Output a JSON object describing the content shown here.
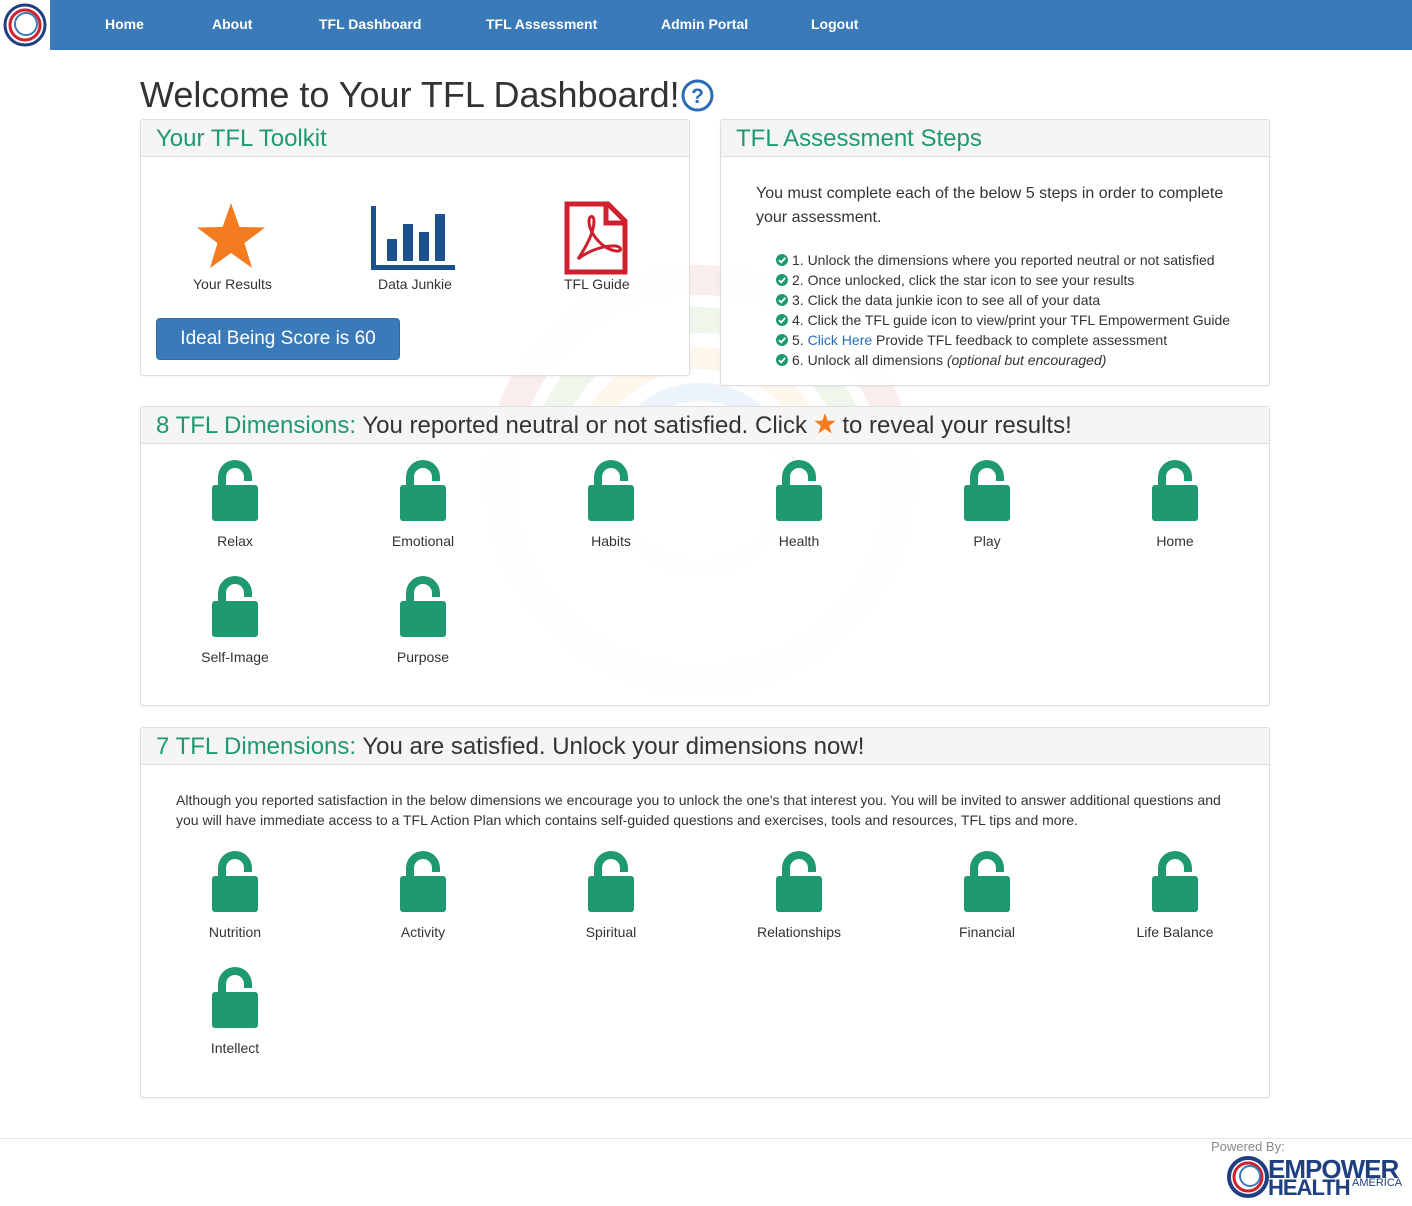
{
  "nav": {
    "items": [
      {
        "label": "Home"
      },
      {
        "label": "About"
      },
      {
        "label": "TFL Dashboard"
      },
      {
        "label": "TFL Assessment"
      },
      {
        "label": "Admin Portal"
      },
      {
        "label": "Logout"
      }
    ]
  },
  "page": {
    "title": "Welcome to Your TFL Dashboard!",
    "help_icon": "question-circle-icon"
  },
  "toolkit": {
    "title": "Your TFL Toolkit",
    "tools": [
      {
        "label": "Your Results",
        "icon": "star-icon"
      },
      {
        "label": "Data Junkie",
        "icon": "bar-chart-icon"
      },
      {
        "label": "TFL Guide",
        "icon": "pdf-icon"
      }
    ],
    "score_button": "Ideal Being Score is 60"
  },
  "steps": {
    "title": "TFL Assessment Steps",
    "intro": "You must complete each of the below 5 steps in order to complete your assessment.",
    "items": [
      {
        "text": "1. Unlock the dimensions where you reported neutral or not satisfied"
      },
      {
        "text": "2. Once unlocked, click the star icon to see your results"
      },
      {
        "text": "3. Click the data junkie icon to see all of your data"
      },
      {
        "text": "4. Click the TFL guide icon to view/print your TFL Empowerment Guide"
      },
      {
        "prefix": "5. ",
        "link": "Click Here",
        "text": " Provide TFL feedback to complete assessment"
      },
      {
        "text": "6. Unlock all dimensions ",
        "em": "(optional but encouraged)"
      }
    ]
  },
  "neutral": {
    "title_count": "8 TFL Dimensions:",
    "title_text_before": " You reported neutral or not satisfied. Click ",
    "title_text_after": " to reveal your results!",
    "dimensions": [
      {
        "label": "Relax"
      },
      {
        "label": "Emotional"
      },
      {
        "label": "Habits"
      },
      {
        "label": "Health"
      },
      {
        "label": "Play"
      },
      {
        "label": "Home"
      },
      {
        "label": "Self-Image"
      },
      {
        "label": "Purpose"
      }
    ]
  },
  "satisfied": {
    "title_count": "7 TFL Dimensions:",
    "title_text": " You are satisfied. Unlock your dimensions now!",
    "description": "Although you reported satisfaction in the below dimensions we encourage you to unlock the one's that interest you. You will be invited to answer additional questions and you will have immediate access to a TFL Action Plan which contains self-guided questions and exercises, tools and resources, TFL tips and more.",
    "dimensions": [
      {
        "label": "Nutrition"
      },
      {
        "label": "Activity"
      },
      {
        "label": "Spiritual"
      },
      {
        "label": "Relationships"
      },
      {
        "label": "Financial"
      },
      {
        "label": "Life Balance"
      },
      {
        "label": "Intellect"
      }
    ]
  },
  "footer": {
    "powered_by": "Powered By:",
    "brand_line1": "EMPOWER",
    "brand_line2": "HEALTH",
    "brand_line3": "AMERICA"
  },
  "colors": {
    "nav_blue": "#3a7ab8",
    "teal": "#1f9a6e",
    "star_orange": "#f47b20",
    "pdf_red": "#d0202e",
    "chart_blue": "#1e4f8f"
  }
}
